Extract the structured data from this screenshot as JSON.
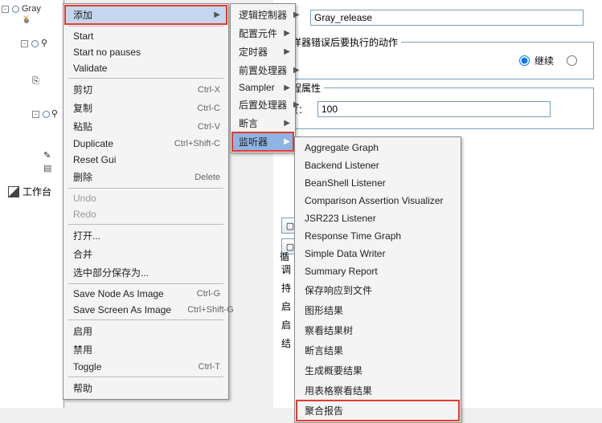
{
  "tree": {
    "root_label": "Gray",
    "workbench_label": "工作台"
  },
  "form": {
    "name_label": "：",
    "name_value": "Gray_release",
    "error_action_label": "样器错误后要执行的动作",
    "continue_label": "继续",
    "thread_attrs_label": "程属性",
    "count_label": "数：",
    "count_value": "100",
    "loop_label": "循",
    "keep_label": "持",
    "start_label": "启",
    "start2_label": "启",
    "end_label": "结",
    "schedule_label": "调"
  },
  "menu1": {
    "add": "添加",
    "start": "Start",
    "start_no_pauses": "Start no pauses",
    "validate": "Validate",
    "cut": "剪切",
    "cut_sc": "Ctrl-X",
    "copy": "复制",
    "copy_sc": "Ctrl-C",
    "paste": "粘贴",
    "paste_sc": "Ctrl-V",
    "duplicate": "Duplicate",
    "duplicate_sc": "Ctrl+Shift-C",
    "reset": "Reset Gui",
    "delete": "删除",
    "delete_sc": "Delete",
    "undo": "Undo",
    "redo": "Redo",
    "open": "打开...",
    "merge": "合并",
    "save_sel": "选中部分保存为...",
    "save_node": "Save Node As Image",
    "save_node_sc": "Ctrl-G",
    "save_screen": "Save Screen As Image",
    "save_screen_sc": "Ctrl+Shift-G",
    "enable": "启用",
    "disable": "禁用",
    "toggle": "Toggle",
    "toggle_sc": "Ctrl-T",
    "help": "帮助"
  },
  "menu2": {
    "logic": "逻辑控制器",
    "config": "配置元件",
    "timer": "定时器",
    "pre": "前置处理器",
    "sampler": "Sampler",
    "post": "后置处理器",
    "assert": "断言",
    "listener": "监听器"
  },
  "menu3": {
    "aggregate_graph": "Aggregate Graph",
    "backend": "Backend Listener",
    "beanshell": "BeanShell Listener",
    "comparison": "Comparison Assertion Visualizer",
    "jsr223": "JSR223 Listener",
    "resp_time": "Response Time Graph",
    "simple_data": "Simple Data Writer",
    "summary": "Summary Report",
    "save_resp": "保存响应到文件",
    "graph_result": "图形结果",
    "view_tree": "察看结果树",
    "assert_result": "断言结果",
    "gen_summary": "生成概要结果",
    "table_view": "用表格察看结果",
    "aggregate_report": "聚合报告"
  }
}
